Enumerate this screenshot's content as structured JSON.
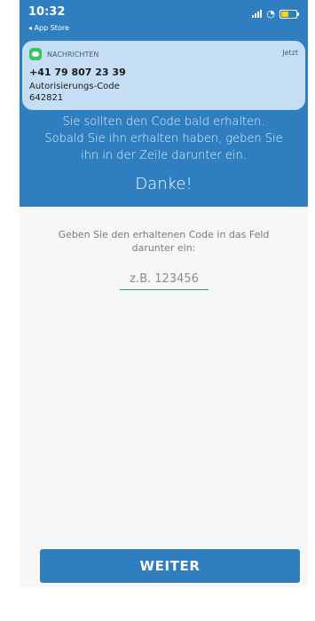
{
  "status_bar": {
    "time": "10:32",
    "back_label": "◂ App Store"
  },
  "notification": {
    "app": "NACHRICHTEN",
    "when": "Jetzt",
    "sender": "+41 79 807 23 39",
    "body_line1": "Autorisierungs-Code",
    "body_line2": "642821"
  },
  "hero": {
    "instruction_line1": "Sie sollten den Code bald erhalten.",
    "instruction_line2": "Sobald Sie ihn erhalten haben, geben Sie",
    "instruction_line3": "ihn in der Zeile darunter ein.",
    "thanks": "Danke!"
  },
  "form": {
    "prompt_line1": "Geben Sie den erhaltenen Code in das Feld",
    "prompt_line2": "darunter ein:",
    "code_placeholder": "z.B. 123456",
    "next_label": "WEITER"
  },
  "colors": {
    "primary": "#2f7fc0",
    "underline": "#2f9a66"
  },
  "icons": {
    "app": "messages-icon",
    "signal": "signal-icon",
    "wifi": "wifi-icon",
    "battery": "battery-icon"
  }
}
